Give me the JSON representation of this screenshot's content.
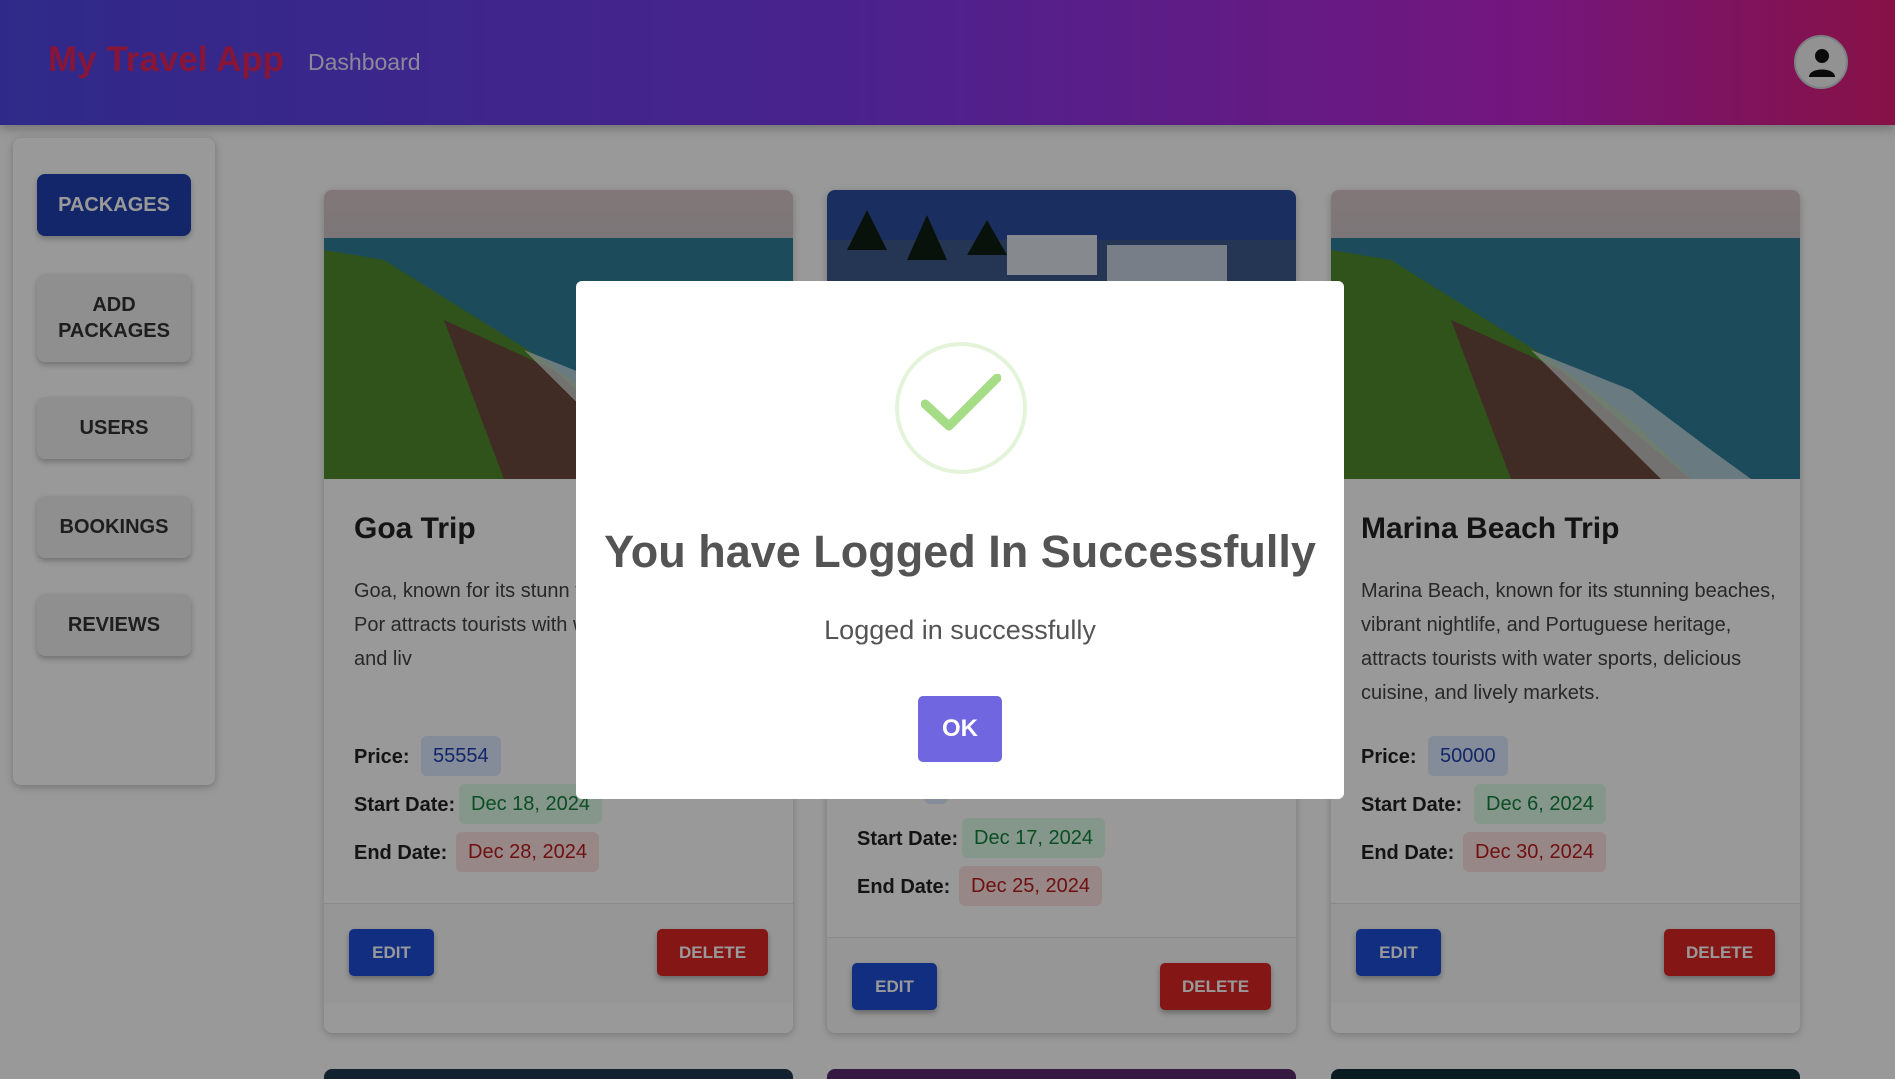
{
  "header": {
    "brand": "My Travel App",
    "nav_dashboard": "Dashboard"
  },
  "sidebar": {
    "items": [
      {
        "label": "PACKAGES",
        "active": true
      },
      {
        "label": "ADD PACKAGES",
        "active": false
      },
      {
        "label": "USERS",
        "active": false
      },
      {
        "label": "BOOKINGS",
        "active": false
      },
      {
        "label": "REVIEWS",
        "active": false
      }
    ]
  },
  "labels": {
    "price": "Price:",
    "start": "Start Date:",
    "end": "End Date:",
    "edit": "EDIT",
    "delete": "DELETE"
  },
  "cards": [
    {
      "title": "Goa Trip",
      "description": "Goa, known for its stunn vibrant nightlife, and Por attracts tourists with wa delicious cuisine, and liv",
      "price": "55554",
      "start_date": "Dec 18, 2024",
      "end_date": "Dec 28, 2024"
    },
    {
      "title": "",
      "description": "",
      "price": "",
      "start_date": "Dec 17, 2024",
      "end_date": "Dec 25, 2024"
    },
    {
      "title": "Marina Beach Trip",
      "description": "Marina Beach, known for its stunning beaches, vibrant nightlife, and Portuguese heritage, attracts tourists with water sports, delicious cuisine, and lively markets.",
      "price": "50000",
      "start_date": "Dec 6, 2024",
      "end_date": "Dec 30, 2024"
    }
  ],
  "modal": {
    "title": "You have Logged In Successfully",
    "text": "Logged in successfully",
    "ok_label": "OK"
  },
  "colors": {
    "primary": "#1e40af",
    "danger": "#dc2626",
    "ok": "#7066e0",
    "brand": "#e0245e"
  }
}
